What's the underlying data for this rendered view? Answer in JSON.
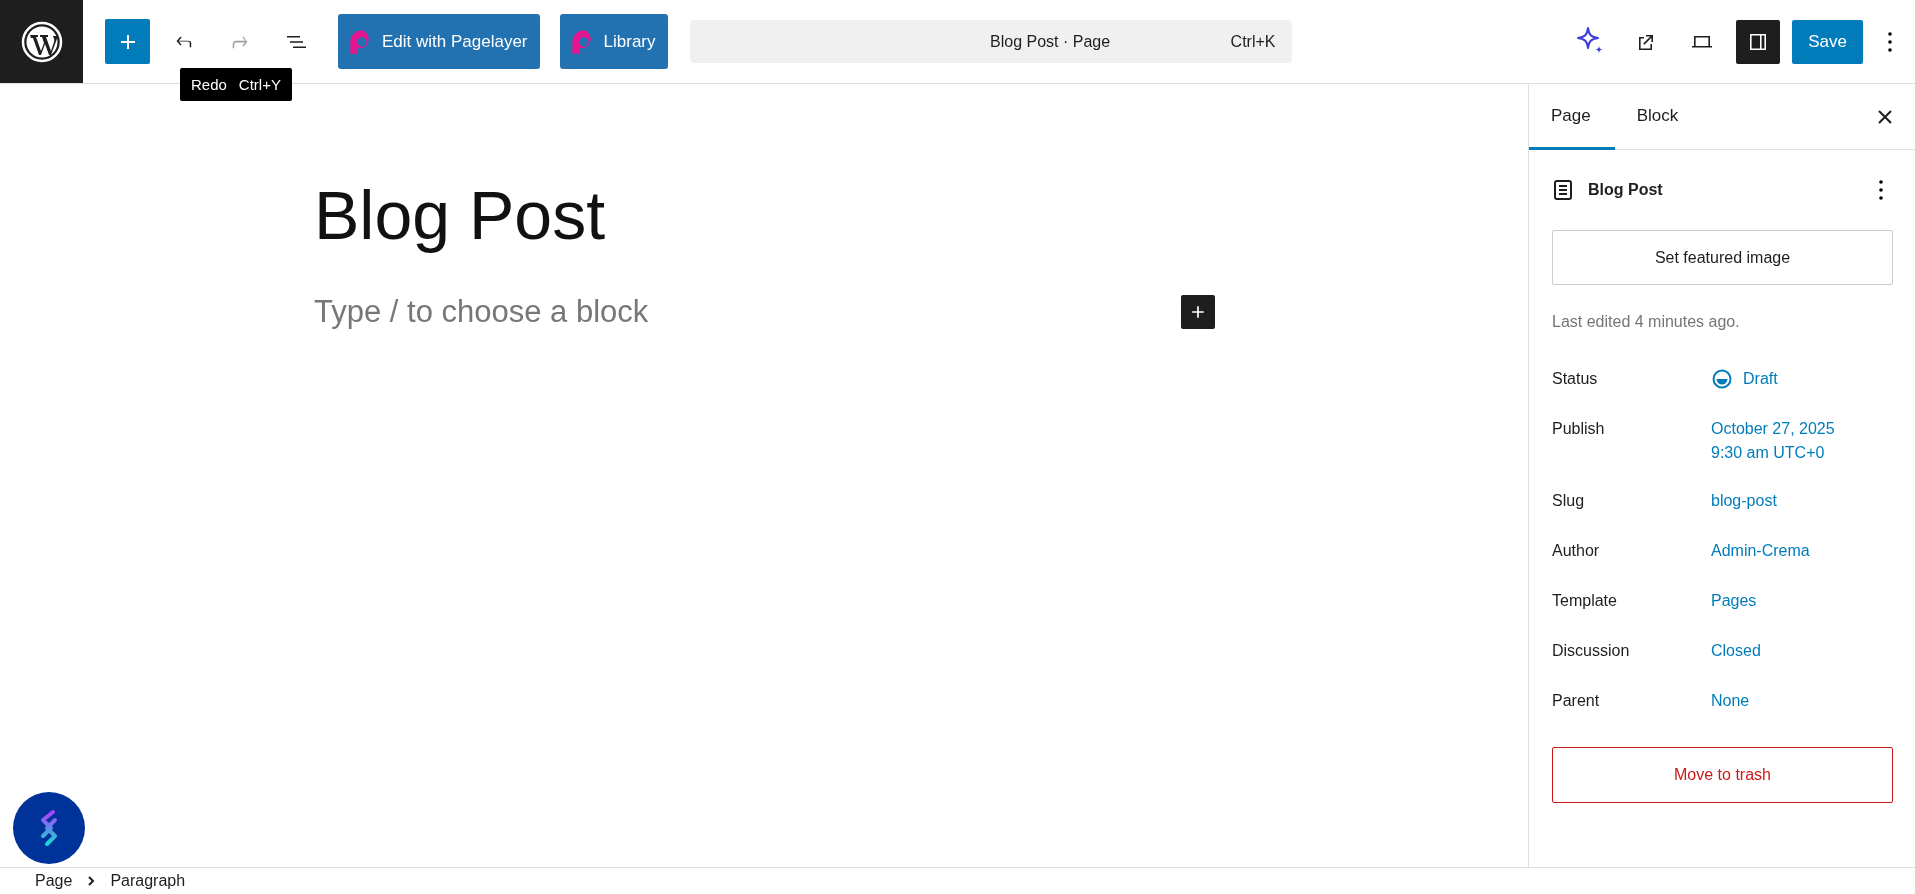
{
  "toolbar": {
    "undo": {
      "disabled": false
    },
    "redo": {
      "disabled": true
    },
    "tooltip": {
      "label": "Redo",
      "shortcut": "Ctrl+Y"
    },
    "pagelayer_buttons": [
      "Edit with Pagelayer",
      "Library"
    ],
    "command_bar": {
      "title": "Blog Post · Page",
      "shortcut": "Ctrl+K"
    },
    "settings_toggle": {
      "selected": true
    },
    "save_button": "Save"
  },
  "editor": {
    "title": "Blog Post",
    "block_placeholder": "Type / to choose a block"
  },
  "sidebar": {
    "tabs": [
      {
        "label": "Page",
        "selected": true
      },
      {
        "label": "Block",
        "selected": false
      }
    ],
    "page_title": "Blog Post",
    "featured_image_button": "Set featured image",
    "last_edited": "Last edited 4 minutes ago.",
    "fields": [
      {
        "label": "Status",
        "kind": "status",
        "lines": [
          "Draft"
        ]
      },
      {
        "label": "Publish",
        "kind": "link",
        "lines": [
          "October 27, 2025",
          "9:30 am UTC+0"
        ]
      },
      {
        "label": "Slug",
        "kind": "link",
        "lines": [
          "blog-post"
        ]
      },
      {
        "label": "Author",
        "kind": "link",
        "lines": [
          "Admin-Crema"
        ]
      },
      {
        "label": "Template",
        "kind": "link",
        "lines": [
          "Pages"
        ]
      },
      {
        "label": "Discussion",
        "kind": "link",
        "lines": [
          "Closed"
        ]
      },
      {
        "label": "Parent",
        "kind": "link",
        "lines": [
          "None"
        ]
      }
    ],
    "trash_button": "Move to trash"
  },
  "breadcrumb": [
    "Page",
    "Paragraph"
  ]
}
